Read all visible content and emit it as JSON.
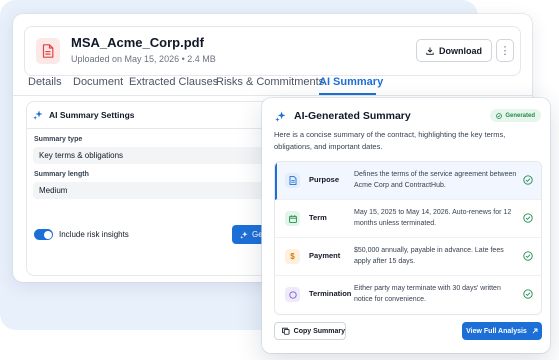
{
  "file": {
    "name": "MSA_Acme_Corp.pdf",
    "meta": "Uploaded on May 15, 2026 • 2.4 MB",
    "icon": "pdf-file-icon",
    "download_label": "Download"
  },
  "tabs": [
    {
      "label": "Details"
    },
    {
      "label": "Document"
    },
    {
      "label": "Extracted Clauses"
    },
    {
      "label": "Risks & Commitments"
    },
    {
      "label": "AI Summary",
      "active": true
    }
  ],
  "settings": {
    "title": "AI Summary Settings",
    "summary_type_label": "Summary type",
    "summary_type_value": "Key terms & obligations",
    "summary_length_label": "Summary length",
    "summary_length_value": "Medium",
    "risk_insights_label": "Include risk insights",
    "risk_insights_on": true,
    "generate_label": "Generate"
  },
  "summary": {
    "title": "AI-Generated Summary",
    "badge": "Generated",
    "intro": "Here is a concise summary of the contract, highlighting the key terms, obligations, and important dates.",
    "rows": [
      {
        "label": "Purpose",
        "text": "Defines the terms of the service agreement between Acme Corp and ContractHub.",
        "icon": "document-icon",
        "color": "#1d6fd8",
        "bg": "#e3edfb"
      },
      {
        "label": "Term",
        "text": "May 15, 2025 to May 14, 2026. Auto-renews for 12 months unless terminated.",
        "icon": "calendar-icon",
        "color": "#1f8a4c",
        "bg": "#e3f5ea"
      },
      {
        "label": "Payment",
        "text": "$50,000 annually, payable in advance. Late fees apply after 15 days.",
        "icon": "dollar-icon",
        "color": "#d97706",
        "bg": "#fdf0dc"
      },
      {
        "label": "Termination",
        "text": "Either party may terminate with 30 days' written notice for convenience.",
        "icon": "circle-icon",
        "color": "#7c5cd6",
        "bg": "#eeeafb"
      }
    ],
    "copy_label": "Copy Summary",
    "full_label": "View Full Analysis"
  },
  "colors": {
    "accent": "#1d6fd8",
    "success": "#1f8a4c",
    "background_blob": "#e8f0fb"
  }
}
